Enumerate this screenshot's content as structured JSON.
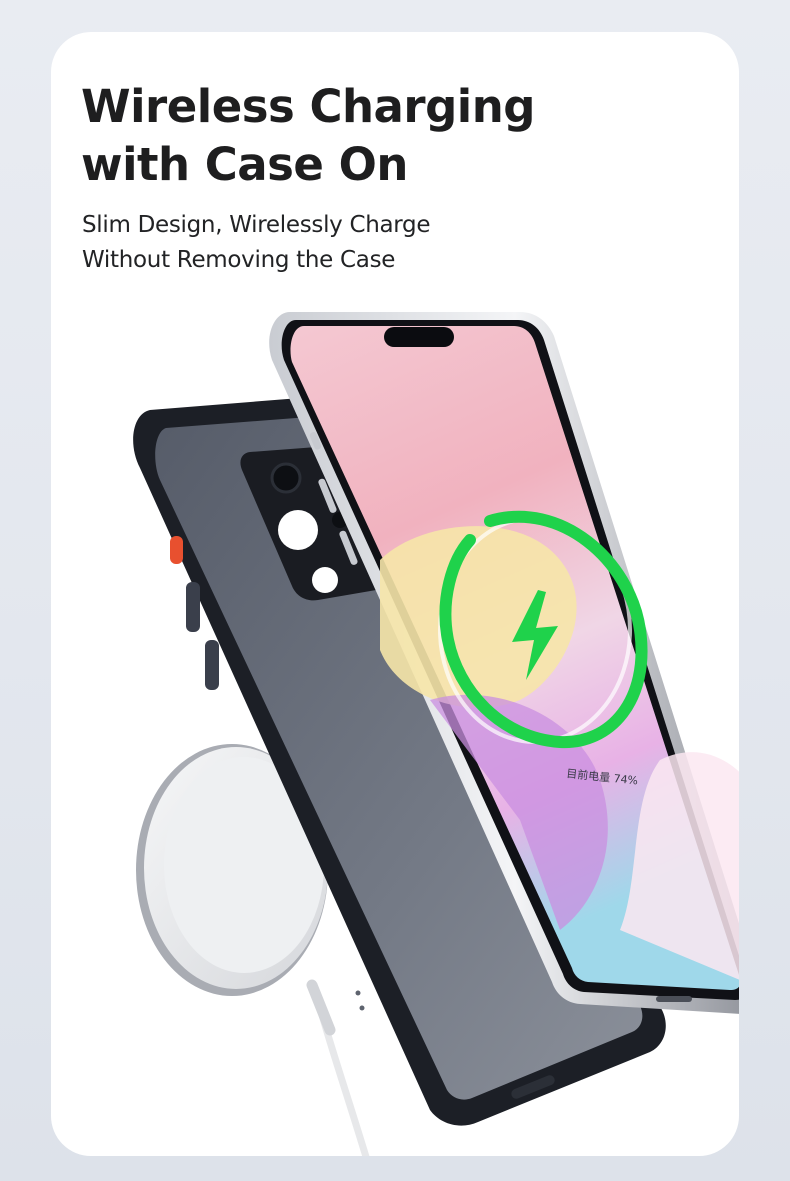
{
  "headline": {
    "line1": "Wireless Charging",
    "line2": "with Case On"
  },
  "subheadline": {
    "line1": "Slim Design, Wirelessly Charge",
    "line2": "Without Removing the Case"
  },
  "phone_screen": {
    "battery_text": "目前电量 74%",
    "battery_level_percent": 74
  },
  "colors": {
    "background": "#e6e9ef",
    "card": "#ffffff",
    "headline": "#1e1e1f",
    "charge_ring": "#1fd24b",
    "case_frame": "#1c1f26",
    "case_back": "#6d737f",
    "power_button_accent": "#e8502f",
    "charger": "#dcdde0"
  }
}
